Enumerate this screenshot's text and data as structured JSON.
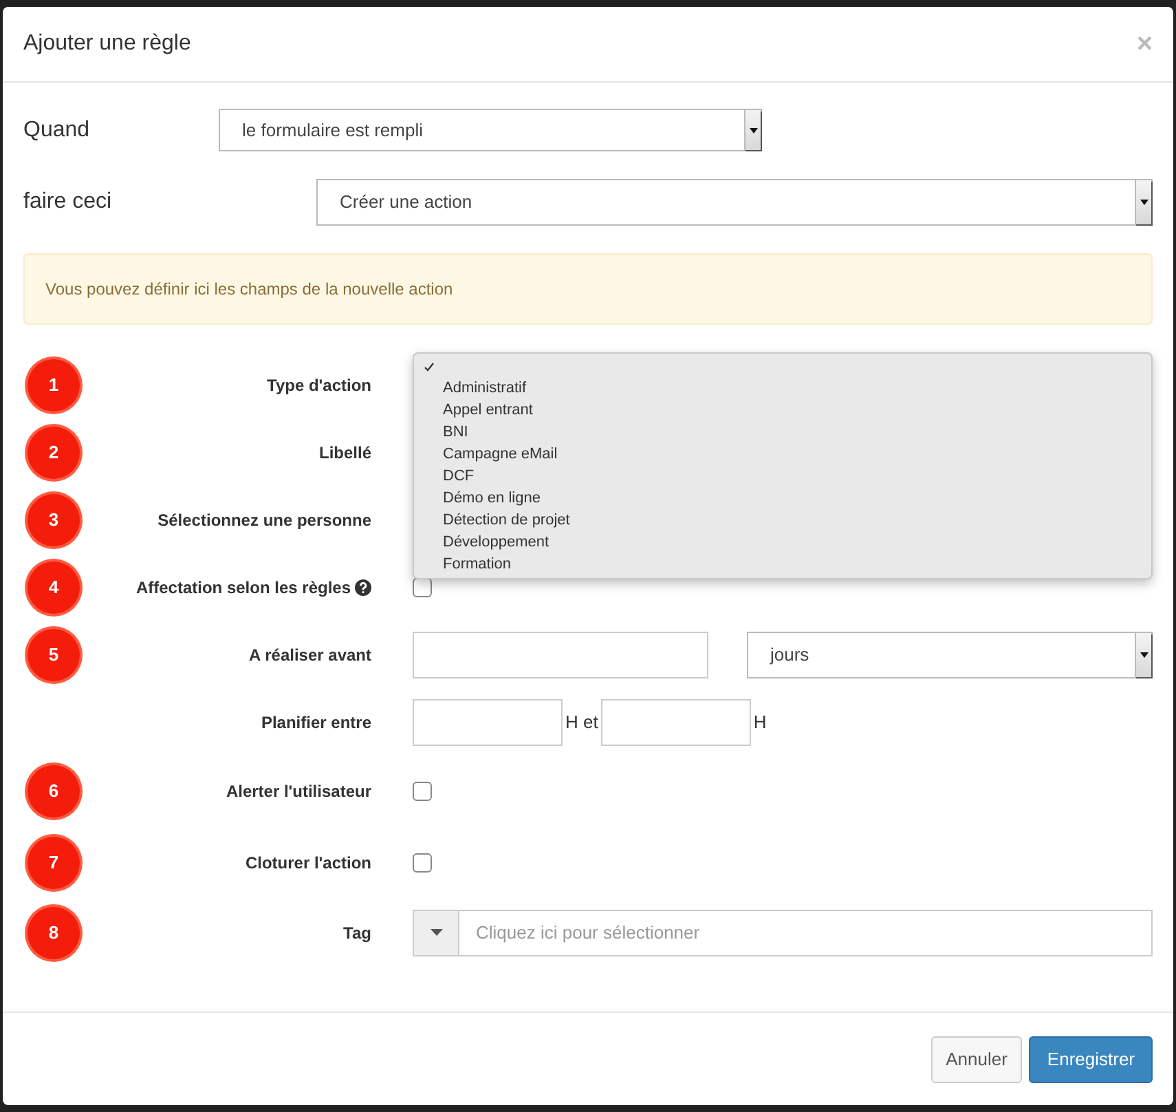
{
  "modal": {
    "title": "Ajouter une règle",
    "close": "×"
  },
  "when": {
    "label": "Quand",
    "value": "le formulaire est rempli"
  },
  "do": {
    "label": "faire ceci",
    "value": "Créer une action"
  },
  "alert": "Vous pouvez définir ici les champs de la nouvelle action",
  "fields": [
    {
      "kind": "covered",
      "badge": "1",
      "label": "Type d'action"
    },
    {
      "kind": "covered",
      "badge": "2",
      "label": "Libellé"
    },
    {
      "kind": "covered",
      "badge": "3",
      "label": "Sélectionnez une personne"
    },
    {
      "kind": "checkbox",
      "badge": "4",
      "label": "Affectation selon les règles",
      "help": true,
      "checked": false
    },
    {
      "kind": "deadline",
      "badge": "5",
      "label": "A réaliser avant",
      "unit": "jours"
    },
    {
      "kind": "hours",
      "label": "Planifier entre",
      "sep": "H et",
      "suffix": "H"
    },
    {
      "kind": "checkbox",
      "badge": "6",
      "label": "Alerter l'utilisateur",
      "help": false,
      "checked": false
    },
    {
      "kind": "checkbox",
      "badge": "7",
      "label": "Cloturer l'action",
      "help": false,
      "checked": false
    },
    {
      "kind": "tag",
      "badge": "8",
      "label": "Tag",
      "placeholder": "Cliquez ici pour sélectionner"
    }
  ],
  "dropdown": {
    "blank_selected": true,
    "options": [
      {
        "label": "Administratif",
        "selected": false
      },
      {
        "label": "Appel entrant",
        "selected": false
      },
      {
        "label": "BNI",
        "selected": false
      },
      {
        "label": "Campagne eMail",
        "selected": false
      },
      {
        "label": "DCF",
        "selected": false
      },
      {
        "label": "Démo en ligne",
        "selected": false
      },
      {
        "label": "Détection de projet",
        "selected": false
      },
      {
        "label": "Développement",
        "selected": false
      },
      {
        "label": "Formation",
        "selected": false
      }
    ]
  },
  "buttons": [
    {
      "label": "Annuler",
      "kind": "secondary"
    },
    {
      "label": "Enregistrer",
      "kind": "primary"
    }
  ]
}
